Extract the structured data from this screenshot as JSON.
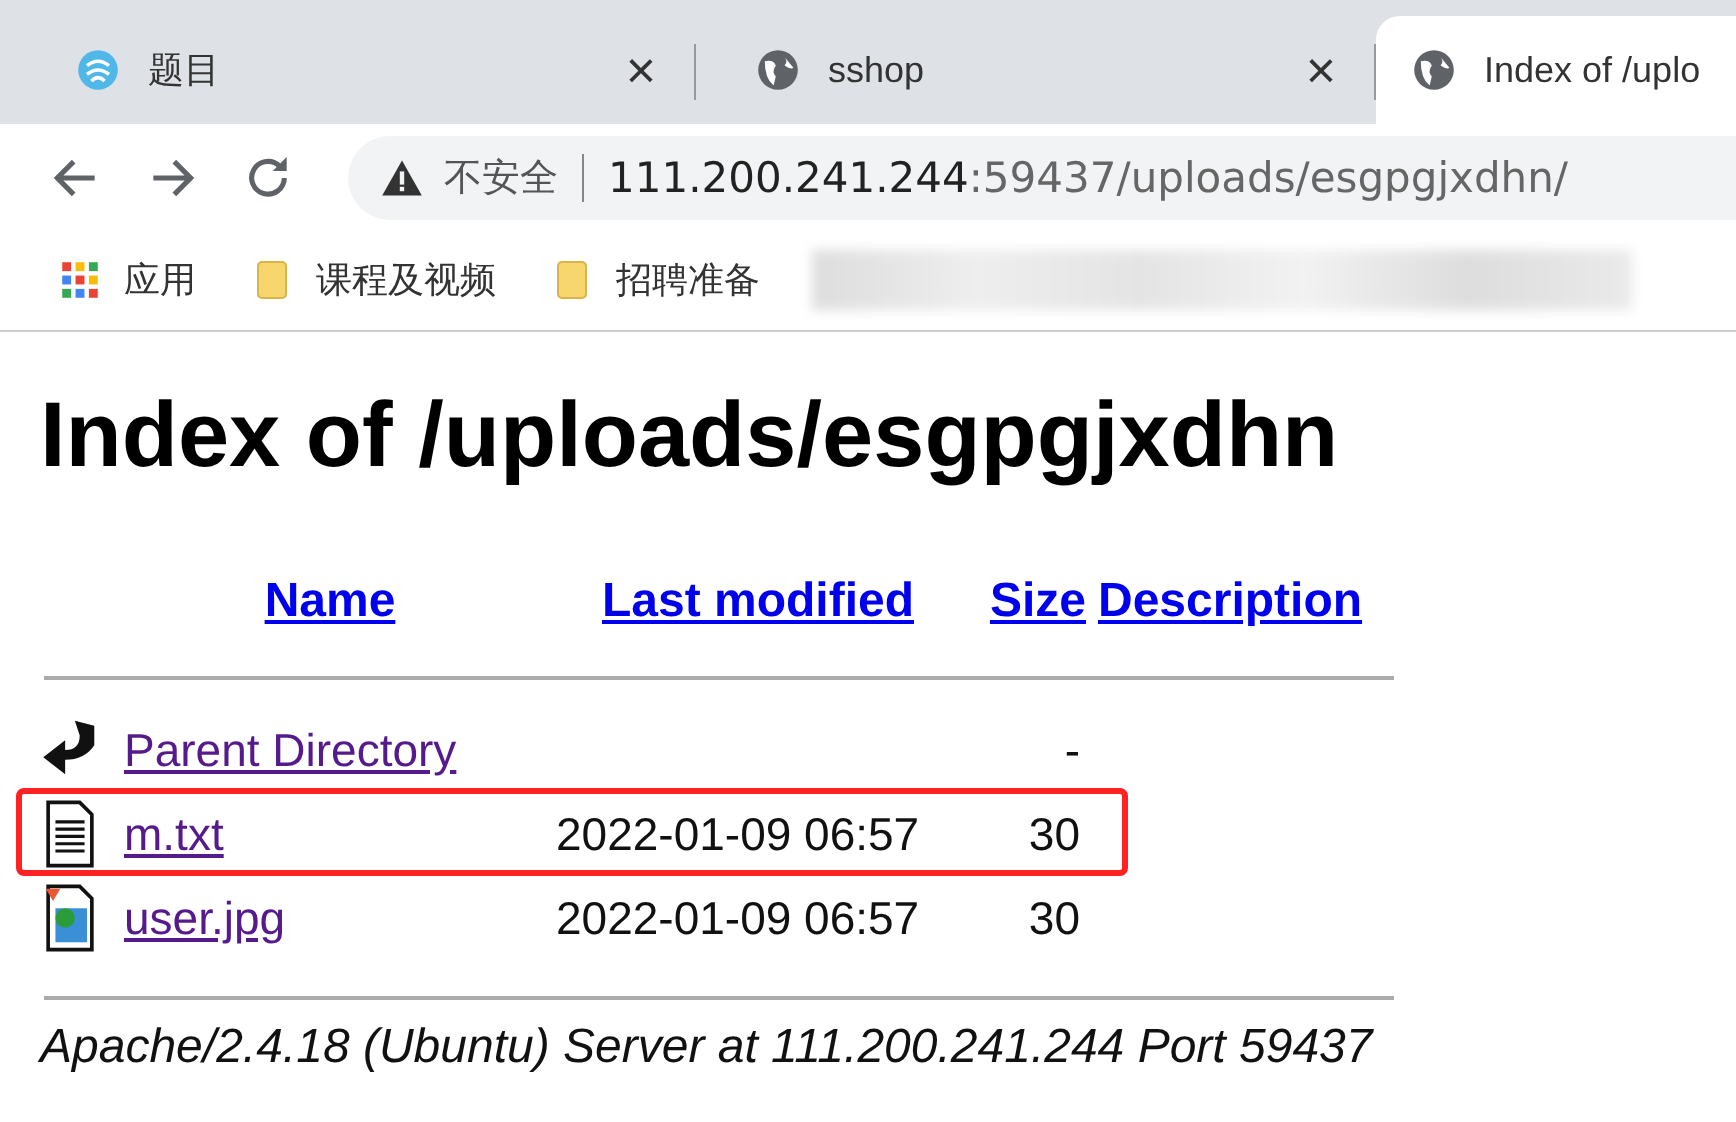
{
  "tabs": [
    {
      "title": "题目",
      "kind": "logo",
      "selected": false,
      "close": "×"
    },
    {
      "title": "sshop",
      "kind": "globe",
      "selected": false,
      "close": "×"
    },
    {
      "title": "Index of /uplo",
      "kind": "globe",
      "selected": true
    }
  ],
  "address": {
    "security": "不安全",
    "host": "111.200.241.244",
    "rest": ":59437/uploads/esgpgjxdhn/"
  },
  "bookmarks": [
    {
      "label": "应用",
      "kind": "apps"
    },
    {
      "label": "课程及视频",
      "kind": "folder"
    },
    {
      "label": "招聘准备",
      "kind": "folder"
    }
  ],
  "heading": "Index of /uploads/esgpgjxdhn",
  "columns": [
    "Name",
    "Last modified",
    "Size",
    "Description"
  ],
  "rows": [
    {
      "kind": "parent",
      "name": "Parent Directory",
      "modified": "",
      "size": "-",
      "visited": true,
      "highlighted": false
    },
    {
      "kind": "text",
      "name": "m.txt",
      "modified": "2022-01-09 06:57",
      "size": "30",
      "visited": true,
      "highlighted": true
    },
    {
      "kind": "image",
      "name": "user.jpg",
      "modified": "2022-01-09 06:57",
      "size": "30",
      "visited": true,
      "highlighted": false
    }
  ],
  "footer": "Apache/2.4.18 (Ubuntu) Server at 111.200.241.244 Port 59437"
}
